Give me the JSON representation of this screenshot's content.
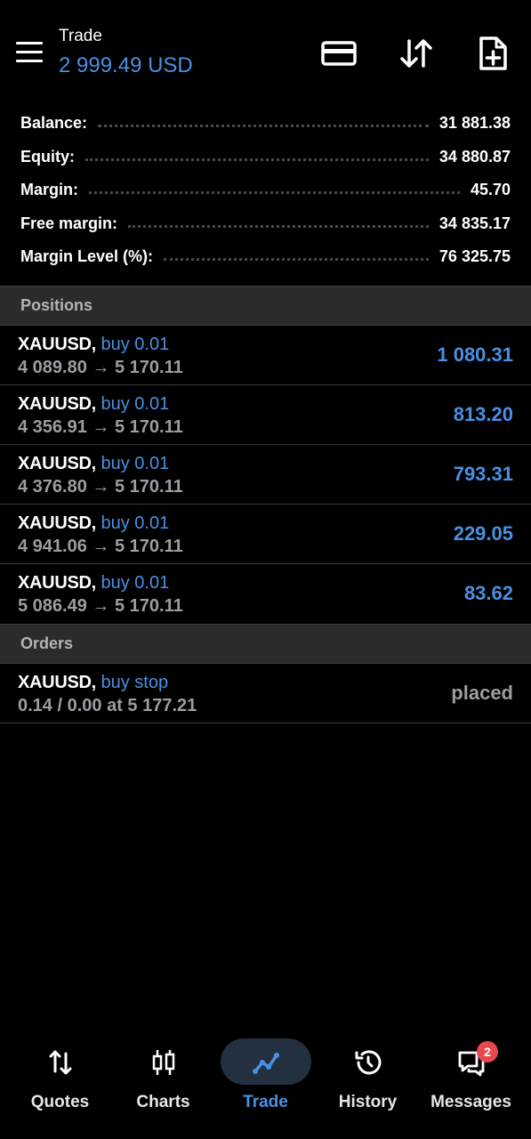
{
  "header": {
    "title": "Trade",
    "balance": "2 999.49 USD"
  },
  "summary": [
    {
      "label": "Balance:",
      "value": "31 881.38"
    },
    {
      "label": "Equity:",
      "value": "34 880.87"
    },
    {
      "label": "Margin:",
      "value": "45.70"
    },
    {
      "label": "Free margin:",
      "value": "34 835.17"
    },
    {
      "label": "Margin Level (%):",
      "value": "76 325.75"
    }
  ],
  "positions": {
    "title": "Positions",
    "items": [
      {
        "symbol": "XAUUSD,",
        "type": "buy 0.01",
        "prices": "4 089.80 → 5 170.11",
        "profit": "1 080.31"
      },
      {
        "symbol": "XAUUSD,",
        "type": "buy 0.01",
        "prices": "4 356.91 → 5 170.11",
        "profit": "813.20"
      },
      {
        "symbol": "XAUUSD,",
        "type": "buy 0.01",
        "prices": "4 376.80 → 5 170.11",
        "profit": "793.31"
      },
      {
        "symbol": "XAUUSD,",
        "type": "buy 0.01",
        "prices": "4 941.06 → 5 170.11",
        "profit": "229.05"
      },
      {
        "symbol": "XAUUSD,",
        "type": "buy 0.01",
        "prices": "5 086.49 → 5 170.11",
        "profit": "83.62"
      }
    ]
  },
  "orders": {
    "title": "Orders",
    "items": [
      {
        "symbol": "XAUUSD,",
        "type": "buy stop",
        "details": "0.14 / 0.00 at 5 177.21",
        "status": "placed"
      }
    ]
  },
  "nav": {
    "quotes": "Quotes",
    "charts": "Charts",
    "trade": "Trade",
    "history": "History",
    "messages": "Messages",
    "messages_badge": "2",
    "active": "trade"
  },
  "colors": {
    "accent": "#4a90e2",
    "section_bg": "#2a2b2d",
    "badge": "#e5484d"
  }
}
